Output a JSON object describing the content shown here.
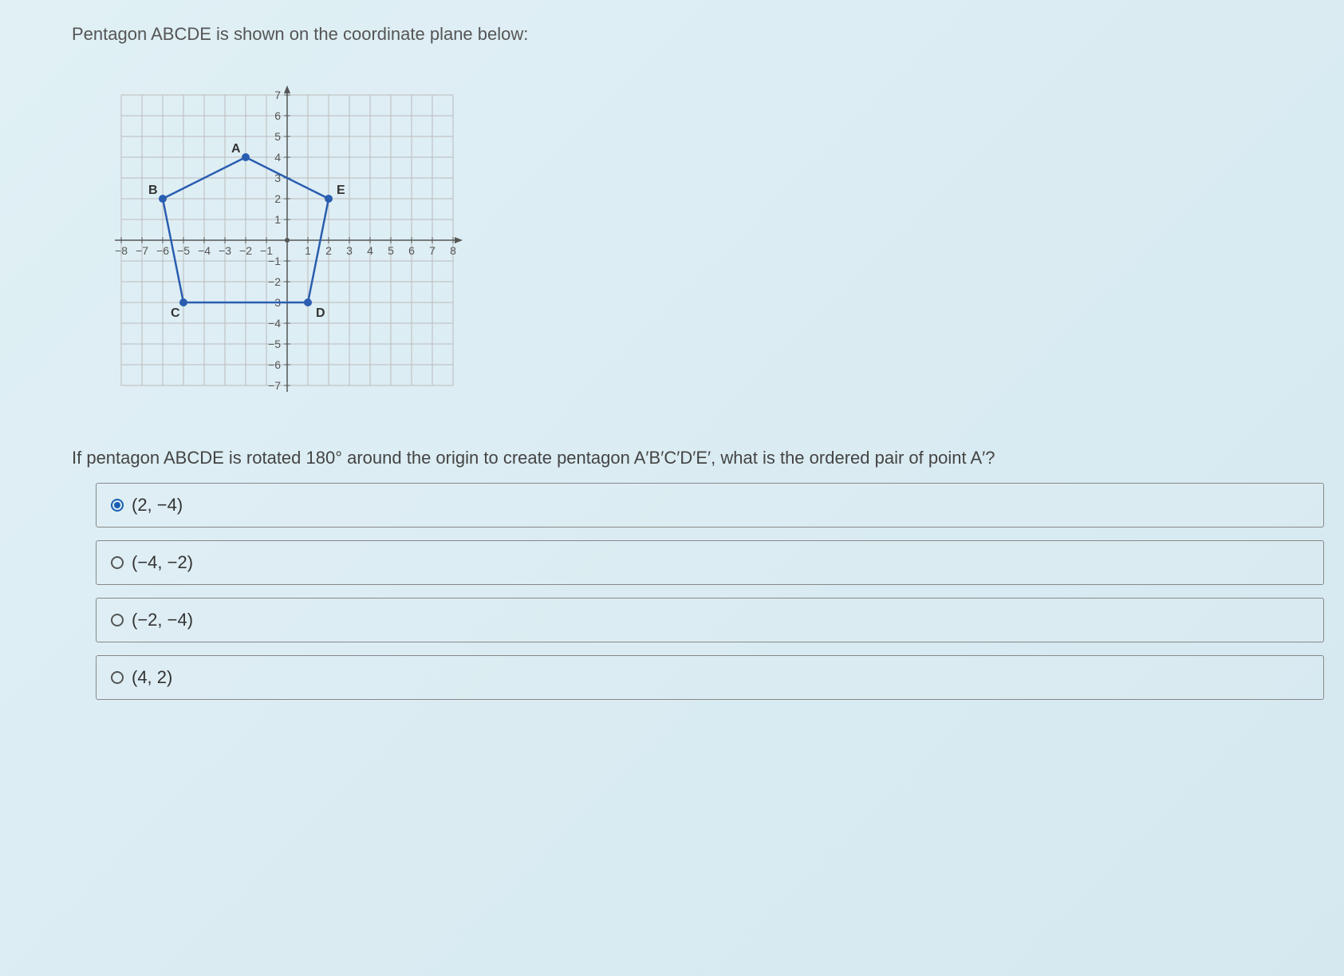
{
  "intro": "Pentagon ABCDE is shown on the coordinate plane below:",
  "question": "If pentagon ABCDE is rotated 180° around the origin to create pentagon A′B′C′D′E′, what is the ordered pair of point A′?",
  "options": {
    "a": "(2, −4)",
    "b": "(−4, −2)",
    "c": "(−2, −4)",
    "d": "(4, 2)"
  },
  "selected": "a",
  "chart_data": {
    "type": "scatter",
    "title": "",
    "xlabel": "",
    "ylabel": "",
    "xlim": [
      -8,
      8
    ],
    "ylim": [
      -7,
      7
    ],
    "x_ticks": [
      -8,
      -7,
      -6,
      -5,
      -4,
      -3,
      -2,
      -1,
      1,
      2,
      3,
      4,
      5,
      6,
      7,
      8
    ],
    "y_ticks": [
      -7,
      -6,
      -5,
      -4,
      -3,
      -2,
      -1,
      1,
      2,
      3,
      4,
      5,
      6,
      7
    ],
    "series": [
      {
        "name": "Pentagon ABCDE",
        "points": [
          {
            "label": "A",
            "x": -2,
            "y": 4
          },
          {
            "label": "B",
            "x": -6,
            "y": 2
          },
          {
            "label": "C",
            "x": -5,
            "y": -3
          },
          {
            "label": "D",
            "x": 1,
            "y": -3
          },
          {
            "label": "E",
            "x": 2,
            "y": 2
          }
        ],
        "closed": true
      }
    ]
  }
}
